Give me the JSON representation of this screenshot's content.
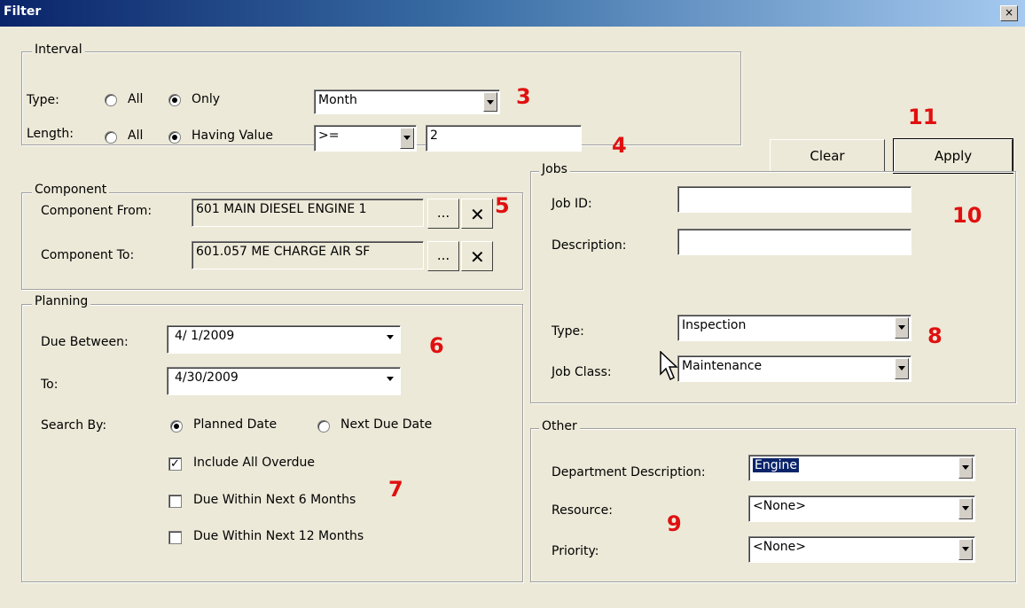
{
  "window": {
    "title": "Filter",
    "close_glyph": "×"
  },
  "interval": {
    "legend": "Interval",
    "type_label": "Type:",
    "type_all": "All",
    "type_only": "Only",
    "type_value": "Month",
    "length_label": "Length:",
    "length_all": "All",
    "length_having": "Having Value",
    "operator_value": ">=",
    "length_value": "2"
  },
  "buttons": {
    "clear": "Clear",
    "apply": "Apply"
  },
  "component": {
    "legend": "Component",
    "from_label": "Component From:",
    "from_value": "601  MAIN DIESEL ENGINE 1",
    "to_label": "Component To:",
    "to_value": "601.057  ME CHARGE AIR SF",
    "browse_label": "...",
    "clear_glyph": "✕"
  },
  "jobs": {
    "legend": "Jobs",
    "job_id_label": "Job ID:",
    "job_id_value": "",
    "description_label": "Description:",
    "description_value": "",
    "type_label": "Type:",
    "type_value": "Inspection",
    "class_label": "Job Class:",
    "class_value": "Maintenance"
  },
  "planning": {
    "legend": "Planning",
    "due_between_label": "Due Between:",
    "due_between_value": "4/  1/2009",
    "to_label": "To:",
    "to_value": "4/30/2009",
    "search_by_label": "Search By:",
    "planned_date": "Planned Date",
    "next_due_date": "Next Due Date",
    "include_overdue": "Include All Overdue",
    "include_overdue_checked": true,
    "due_6": "Due Within Next 6 Months",
    "due_6_checked": false,
    "due_12": "Due Within Next 12 Months",
    "due_12_checked": false
  },
  "other": {
    "legend": "Other",
    "department_label": "Department Description:",
    "department_value": "Engine",
    "resource_label": "Resource:",
    "resource_value": "<None>",
    "priority_label": "Priority:",
    "priority_value": "<None>"
  },
  "annotations": {
    "n3": "3",
    "n4": "4",
    "n5": "5",
    "n6": "6",
    "n7": "7",
    "n8": "8",
    "n9": "9",
    "n10": "10",
    "n11": "11"
  },
  "icons": {
    "cursor": "mouse-pointer-icon"
  }
}
